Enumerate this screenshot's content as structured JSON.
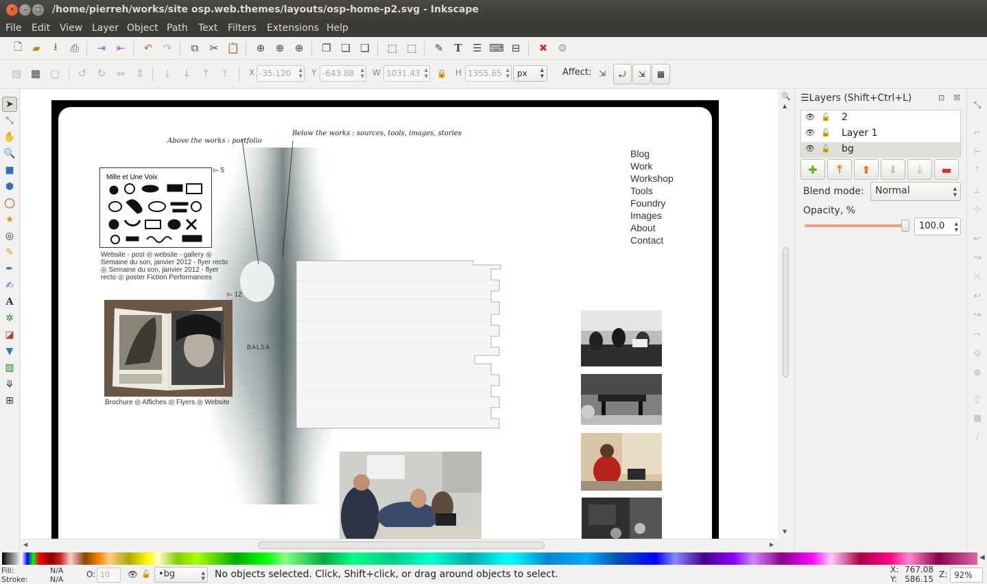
{
  "window": {
    "title": "/home/pierreh/works/site osp.web.themes/layouts/osp-home-p2.svg - Inkscape"
  },
  "menu": [
    "File",
    "Edit",
    "View",
    "Layer",
    "Object",
    "Path",
    "Text",
    "Filters",
    "Extensions",
    "Help"
  ],
  "toolcontrols": {
    "x_label": "X",
    "x_value": "-35.120",
    "y_label": "Y",
    "y_value": "-643.88",
    "w_label": "W",
    "w_value": "1031.43",
    "h_label": "H",
    "h_value": "1355.65",
    "unit": "px",
    "affect_label": "Affect:"
  },
  "document": {
    "above_label": "Above the works : portfolio",
    "below_label": "Below the works : sources, tools, images, stories",
    "thumb1_title": "Mille et Une Voix",
    "count1": "▻ 5",
    "caption1_l1": "Website - post ◎ website - gallery ◎",
    "caption1_l2": "Semaine du son, janvier 2012 - flyer recto",
    "caption1_l3": "◎ Semaine du son, janvier 2012 - flyer",
    "caption1_l4": "recto ◎ poster Fiction Performances",
    "count2": "▻ 12",
    "caption2": "Brochure ◎ Affiches ◎ Flyers ◎ Website",
    "balsa": "BALSA",
    "nav": [
      "Blog",
      "Work",
      "Workshop",
      "Tools",
      "Foundry",
      "Images",
      "About",
      "Contact"
    ]
  },
  "layers_panel": {
    "title": "Layers (Shift+Ctrl+L)",
    "layers": [
      {
        "name": "2"
      },
      {
        "name": "Layer 1"
      },
      {
        "name": "bg"
      }
    ],
    "selected_layer": "bg",
    "blend_label": "Blend mode:",
    "blend_value": "Normal",
    "opacity_label": "Opacity, %",
    "opacity_value": "100.0"
  },
  "status": {
    "fill_label": "Fill:",
    "fill_value": "N/A",
    "stroke_label": "Stroke:",
    "stroke_value": "N/A",
    "o_label": "O:",
    "o_value": "10",
    "current_layer": "•bg",
    "message": "No objects selected. Click, Shift+click, or drag around objects to select.",
    "x_label": "X:",
    "x_value": "767.08",
    "y_label": "Y:",
    "y_value": "586.15",
    "z_label": "Z:",
    "zoom": "92%"
  },
  "colors": {
    "titlebar": "#3c3b37",
    "close": "#df4a16",
    "remove_layer": "#d8312e",
    "add_layer": "#5fae1e",
    "raise_layer": "#e8791d"
  }
}
